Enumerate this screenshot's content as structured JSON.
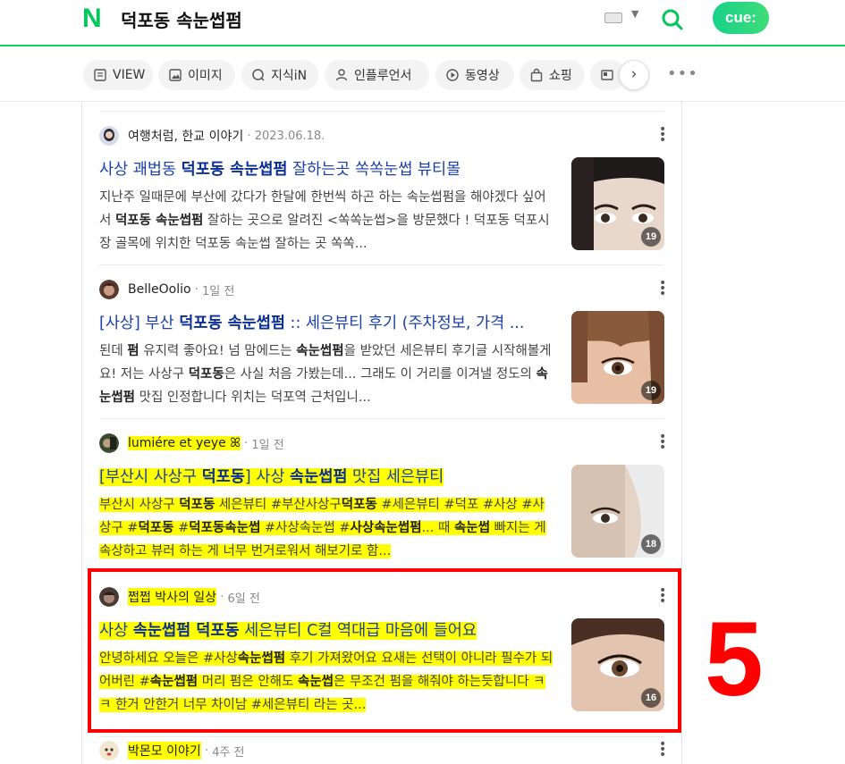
{
  "header": {
    "logo_letter": "N",
    "query": "덕포동 속눈썹펌",
    "cue_label": "cue:",
    "brand_color": "#03c75a"
  },
  "tabs": [
    {
      "label": "VIEW",
      "icon": "view-icon"
    },
    {
      "label": "이미지",
      "icon": "image-icon"
    },
    {
      "label": "지식iN",
      "icon": "question-icon"
    },
    {
      "label": "인플루언서",
      "icon": "person-icon"
    },
    {
      "label": "동영상",
      "icon": "play-icon"
    },
    {
      "label": "쇼핑",
      "icon": "shopping-bag-icon"
    },
    {
      "label": "",
      "icon": "news-icon"
    }
  ],
  "results": [
    {
      "author": "여행처럼, 한교 이야기",
      "date": "2023.06.18.",
      "title_parts": [
        {
          "t": "사상 괘법동 ",
          "b": false
        },
        {
          "t": "덕포동 속눈썹펌",
          "b": true
        },
        {
          "t": " 잘하는곳 쏙쏙눈썹 뷰티몰",
          "b": false
        }
      ],
      "desc_parts": [
        {
          "t": "지난주 일때문에 부산에 갔다가 한달에 한번씩 하곤 하는 속눈썹펌을 해야겠다 싶어서 ",
          "b": false
        },
        {
          "t": "덕포동 속눈썹펌",
          "b": true
        },
        {
          "t": " 잘하는 곳으로 알려진 <쏙쏙눈썹>을 방문했다 ! 덕포동 덕포시장 골목에 위치한 덕포동 속눈썹 잘하는 곳 쏙쏙...",
          "b": false
        }
      ],
      "image_count": "19",
      "highlighted": false
    },
    {
      "author": "BelleOolio",
      "date": "1일 전",
      "title_parts": [
        {
          "t": "[사상] 부산 ",
          "b": false
        },
        {
          "t": "덕포동 속눈썹펌",
          "b": true
        },
        {
          "t": " :: 세은뷰티 후기 (주차정보, 가격 ...",
          "b": false
        }
      ],
      "desc_parts": [
        {
          "t": "된데 ",
          "b": false
        },
        {
          "t": "펌",
          "b": true
        },
        {
          "t": " 유지력 좋아요! 넘 맘에드는 ",
          "b": false
        },
        {
          "t": "속눈썹펌",
          "b": true
        },
        {
          "t": "을 받았던 세은뷰티 후기글 시작해볼게요! 저는 사상구 ",
          "b": false
        },
        {
          "t": "덕포동",
          "b": true
        },
        {
          "t": "은 사실 처음 가봤는데... 그래도 이 거리를 이겨낼 정도의 ",
          "b": false
        },
        {
          "t": "속눈썹펌",
          "b": true
        },
        {
          "t": " 맛집 인정합니다 위치는 덕포역 근처입니...",
          "b": false
        }
      ],
      "image_count": "19",
      "highlighted": false
    },
    {
      "author": "lumiére et yeye ꕤ",
      "date": "1일 전",
      "title_parts": [
        {
          "t": "[부산시 사상구 ",
          "b": false
        },
        {
          "t": "덕포동",
          "b": true
        },
        {
          "t": "] 사상 ",
          "b": false
        },
        {
          "t": "속눈썹펌",
          "b": true
        },
        {
          "t": " 맛집 세은뷰티",
          "b": false
        }
      ],
      "desc_parts": [
        {
          "t": "부산시 사상구 ",
          "b": false
        },
        {
          "t": "덕포동",
          "b": true
        },
        {
          "t": " 세은뷰티 #부산사상구",
          "b": false
        },
        {
          "t": "덕포동",
          "b": true
        },
        {
          "t": " #세은뷰티 #덕포 #사상 #사상구 #",
          "b": false
        },
        {
          "t": "덕포동",
          "b": true
        },
        {
          "t": " #",
          "b": false
        },
        {
          "t": "덕포동속눈썹",
          "b": true
        },
        {
          "t": " #사상속눈썹 #",
          "b": false
        },
        {
          "t": "사상속눈썹펌",
          "b": true
        },
        {
          "t": "... 때 ",
          "b": false
        },
        {
          "t": "속눈썹",
          "b": true
        },
        {
          "t": " 빠지는 게 속상하고 뷰러 하는 게 너무 번거로워서 해보기로 함...",
          "b": false
        }
      ],
      "image_count": "18",
      "highlighted": true
    },
    {
      "author": "쩝쩝 박사의 일상",
      "date": "6일 전",
      "title_parts": [
        {
          "t": "사상 ",
          "b": false
        },
        {
          "t": "속눈썹펌 덕포동",
          "b": true
        },
        {
          "t": " 세은뷰티 C컬 역대급 마음에 들어요",
          "b": false
        }
      ],
      "desc_parts": [
        {
          "t": "안녕하세요 오늘은 #사상",
          "b": false
        },
        {
          "t": "속눈썹펌",
          "b": true
        },
        {
          "t": " 후기 가져왔어요 요새는 선택이 아니라 필수가 되어버린 #",
          "b": false
        },
        {
          "t": "속눈썹펌",
          "b": true
        },
        {
          "t": " 머리 펌은 안해도 ",
          "b": false
        },
        {
          "t": "속눈썹",
          "b": true
        },
        {
          "t": "은 무조건 펌을 해줘야 하는듯합니다 ㅋㅋ 한거 안한거 너무 차이남 #세은뷰티 라는 곳...",
          "b": false
        }
      ],
      "image_count": "16",
      "highlighted": true
    },
    {
      "author": "박몬모 이야기",
      "date": "4주 전",
      "highlighted": true
    }
  ],
  "annotation_number": "5",
  "annotation_color": "#ff0000",
  "highlight_color": "#ffff00"
}
